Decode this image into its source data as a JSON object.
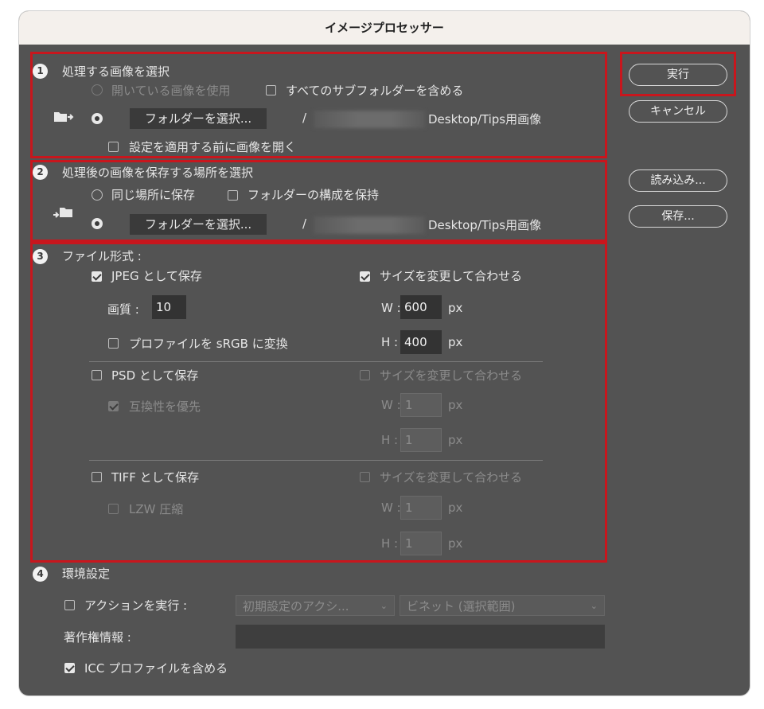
{
  "window": {
    "title": "イメージプロセッサー"
  },
  "actions": {
    "run": "実行",
    "cancel": "キャンセル",
    "load": "読み込み...",
    "save": "保存..."
  },
  "section1": {
    "number": "1",
    "title": "処理する画像を選択",
    "use_open_images": "開いている画像を使用",
    "include_subfolders": "すべてのサブフォルダーを含める",
    "select_folder": "フォルダーを選択...",
    "path_prefix": "/",
    "path_suffix": "Desktop/Tips用画像",
    "open_before_apply": "設定を適用する前に画像を開く"
  },
  "section2": {
    "number": "2",
    "title": "処理後の画像を保存する場所を選択",
    "same_location": "同じ場所に保存",
    "keep_structure": "フォルダーの構成を保持",
    "select_folder": "フォルダーを選択...",
    "path_prefix": "/",
    "path_suffix": "Desktop/Tips用画像"
  },
  "section3": {
    "number": "3",
    "title": "ファイル形式 :",
    "jpeg": {
      "label": "JPEG として保存",
      "resize": "サイズを変更して合わせる",
      "quality_label": "画質 :",
      "quality": "10",
      "convert_srgb": "プロファイルを sRGB に変換",
      "w_label": "W :",
      "w": "600",
      "h_label": "H :",
      "h": "400",
      "unit": "px"
    },
    "psd": {
      "label": "PSD として保存",
      "resize": "サイズを変更して合わせる",
      "compat": "互換性を優先",
      "w_label": "W :",
      "w": "1",
      "h_label": "H :",
      "h": "1",
      "unit": "px"
    },
    "tiff": {
      "label": "TIFF として保存",
      "resize": "サイズを変更して合わせる",
      "lzw": "LZW 圧縮",
      "w_label": "W :",
      "w": "1",
      "h_label": "H :",
      "h": "1",
      "unit": "px"
    }
  },
  "section4": {
    "number": "4",
    "title": "環境設定",
    "run_action": "アクションを実行 :",
    "action_set": "初期設定のアクシ...",
    "action_name": "ビネット (選択範囲)",
    "copyright_label": "著作権情報 :",
    "copyright": "",
    "include_icc": "ICC プロファイルを含める"
  },
  "icons": {
    "source_folder": "folder-arrow-icon",
    "dest_folder": "arrow-folder-icon",
    "dropdown": "chevron-down-icon"
  },
  "colors": {
    "highlight": "#c8161d",
    "panel": "#535353",
    "titlebar": "#f4f0ec"
  }
}
